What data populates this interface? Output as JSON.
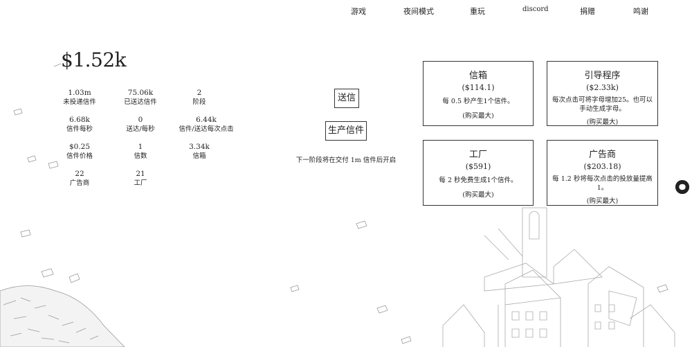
{
  "nav": [
    {
      "label": "游戏"
    },
    {
      "label": "夜间模式"
    },
    {
      "label": "重玩"
    },
    {
      "label": "discord"
    },
    {
      "label": "捐赠"
    },
    {
      "label": "鸣谢"
    }
  ],
  "money": "$1.52k",
  "stats": [
    {
      "value": "1.03m",
      "label": "未投递信件"
    },
    {
      "value": "75.06k",
      "label": "已送达信件"
    },
    {
      "value": "2",
      "label": "阶段"
    },
    {
      "value": "6.68k",
      "label": "信件每秒"
    },
    {
      "value": "0",
      "label": "送达/每秒"
    },
    {
      "value": "6.44k",
      "label": "信件/送达每次点击"
    },
    {
      "value": "$0.25",
      "label": "信件价格"
    },
    {
      "value": "1",
      "label": "信数"
    },
    {
      "value": "3.34k",
      "label": "信箱"
    },
    {
      "value": "22",
      "label": "广告商"
    },
    {
      "value": "21",
      "label": "工厂"
    }
  ],
  "actions": {
    "send": "送信",
    "produce": "生产信件"
  },
  "next_stage": "下一阶段将在交付 1m 信件后开启",
  "shop": [
    {
      "title": "信箱",
      "price": "($114.1)",
      "desc": "每 0.5 秒产生1个信件。",
      "buy": "(购买最大)"
    },
    {
      "title": "引导程序",
      "price": "($2.33k)",
      "desc": "每次点击可将字母增加25。也可以手动生成字母。",
      "buy": "(购买最大)"
    },
    {
      "title": "工厂",
      "price": "($591)",
      "desc": "每 2 秒免费生成1个信件。",
      "buy": "(购买最大)"
    },
    {
      "title": "广告商",
      "price": "($203.18)",
      "desc": "每 1.2 秒将每次点击的投放量提高1。",
      "buy": "(购买最大)"
    }
  ],
  "icons": {
    "side": "github-icon"
  }
}
